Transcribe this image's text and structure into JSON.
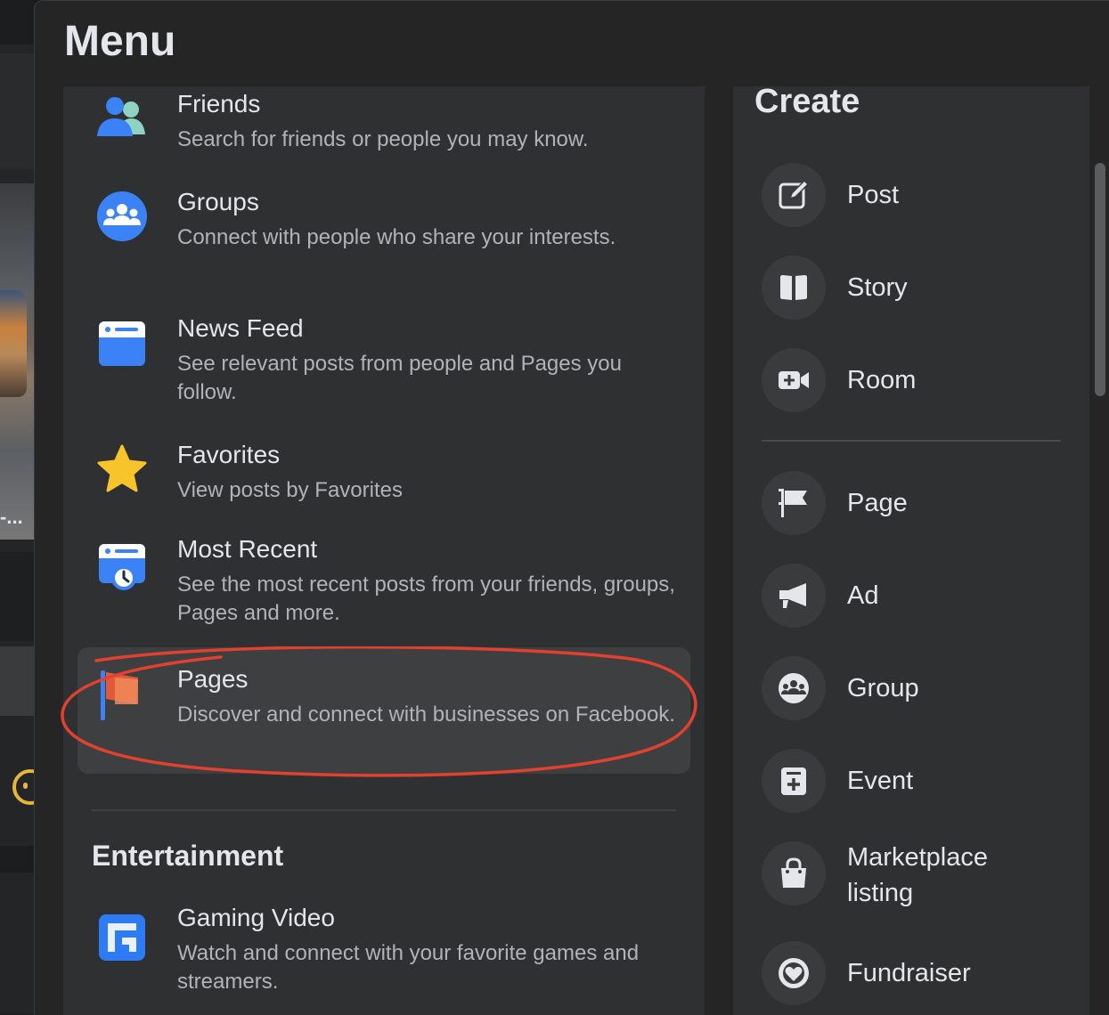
{
  "menu": {
    "title": "Menu"
  },
  "items": [
    {
      "title": "Friends",
      "desc": "Search for friends or people you may know.",
      "icon": "friends-icon"
    },
    {
      "title": "Groups",
      "desc": "Connect with people who share your interests.",
      "icon": "groups-icon"
    },
    {
      "title": "News Feed",
      "desc": "See relevant posts from people and Pages you follow.",
      "icon": "news-feed-icon"
    },
    {
      "title": "Favorites",
      "desc": "View posts by Favorites",
      "icon": "star-icon"
    },
    {
      "title": "Most Recent",
      "desc": "See the most recent posts from your friends, groups, Pages and more.",
      "icon": "most-recent-icon"
    },
    {
      "title": "Pages",
      "desc": "Discover and connect with businesses on Facebook.",
      "icon": "pages-flag-icon"
    }
  ],
  "entertainment": {
    "title": "Entertainment",
    "items": [
      {
        "title": "Gaming Video",
        "desc": "Watch and connect with your favorite games and streamers.",
        "icon": "gaming-video-icon"
      }
    ]
  },
  "create": {
    "title": "Create",
    "primary": [
      {
        "label": "Post",
        "icon": "edit-icon"
      },
      {
        "label": "Story",
        "icon": "book-icon"
      },
      {
        "label": "Room",
        "icon": "video-plus-icon"
      }
    ],
    "secondary": [
      {
        "label": "Page",
        "icon": "flag-icon"
      },
      {
        "label": "Ad",
        "icon": "megaphone-icon"
      },
      {
        "label": "Group",
        "icon": "group-icon"
      },
      {
        "label": "Event",
        "icon": "calendar-plus-icon"
      },
      {
        "label": "Marketplace listing",
        "icon": "shopping-bag-icon"
      },
      {
        "label": "Fundraiser",
        "icon": "heart-coin-icon"
      }
    ]
  },
  "background": {
    "truncated_text": "-..."
  },
  "colors": {
    "panel": "#252526",
    "column": "#2f3031",
    "highlight": "#3e3f40",
    "text_primary": "#e4e6eb",
    "text_secondary": "#b0b3b8",
    "annotation": "#e2412f"
  }
}
